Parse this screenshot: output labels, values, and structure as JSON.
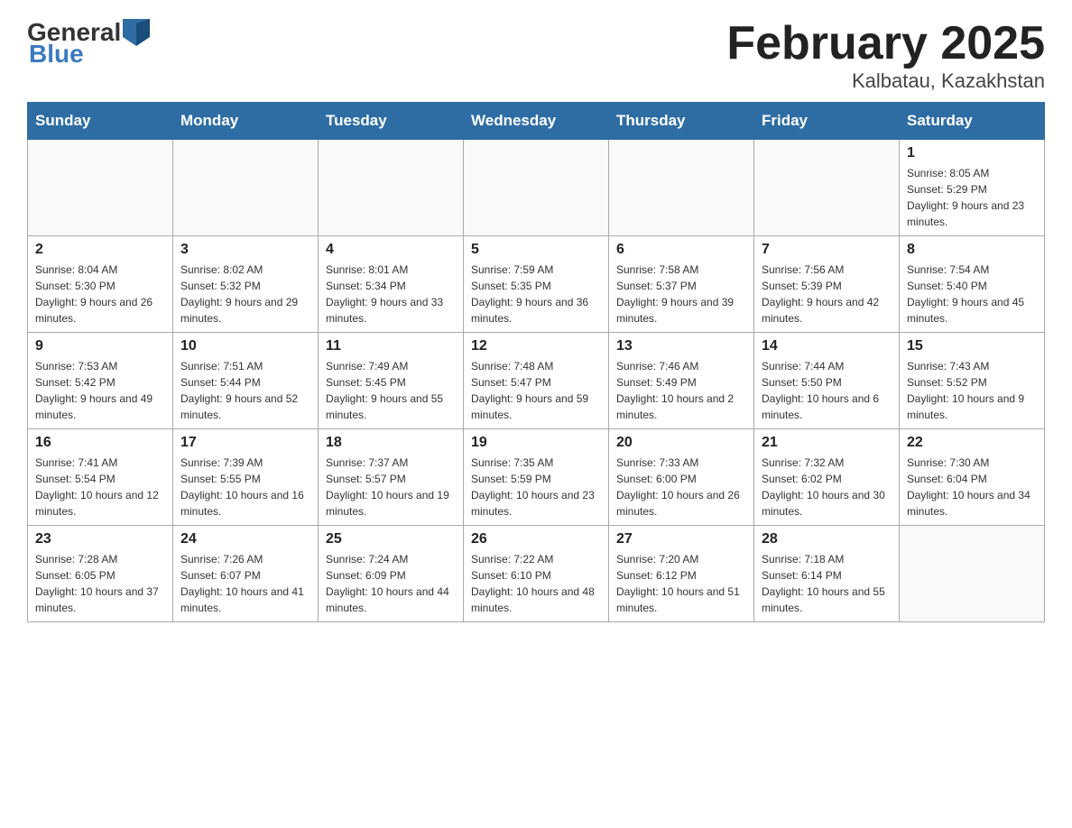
{
  "header": {
    "logo_general": "General",
    "logo_blue": "Blue",
    "month_title": "February 2025",
    "location": "Kalbatau, Kazakhstan"
  },
  "days_of_week": [
    "Sunday",
    "Monday",
    "Tuesday",
    "Wednesday",
    "Thursday",
    "Friday",
    "Saturday"
  ],
  "weeks": [
    [
      {
        "day": "",
        "sunrise": "",
        "sunset": "",
        "daylight": ""
      },
      {
        "day": "",
        "sunrise": "",
        "sunset": "",
        "daylight": ""
      },
      {
        "day": "",
        "sunrise": "",
        "sunset": "",
        "daylight": ""
      },
      {
        "day": "",
        "sunrise": "",
        "sunset": "",
        "daylight": ""
      },
      {
        "day": "",
        "sunrise": "",
        "sunset": "",
        "daylight": ""
      },
      {
        "day": "",
        "sunrise": "",
        "sunset": "",
        "daylight": ""
      },
      {
        "day": "1",
        "sunrise": "Sunrise: 8:05 AM",
        "sunset": "Sunset: 5:29 PM",
        "daylight": "Daylight: 9 hours and 23 minutes."
      }
    ],
    [
      {
        "day": "2",
        "sunrise": "Sunrise: 8:04 AM",
        "sunset": "Sunset: 5:30 PM",
        "daylight": "Daylight: 9 hours and 26 minutes."
      },
      {
        "day": "3",
        "sunrise": "Sunrise: 8:02 AM",
        "sunset": "Sunset: 5:32 PM",
        "daylight": "Daylight: 9 hours and 29 minutes."
      },
      {
        "day": "4",
        "sunrise": "Sunrise: 8:01 AM",
        "sunset": "Sunset: 5:34 PM",
        "daylight": "Daylight: 9 hours and 33 minutes."
      },
      {
        "day": "5",
        "sunrise": "Sunrise: 7:59 AM",
        "sunset": "Sunset: 5:35 PM",
        "daylight": "Daylight: 9 hours and 36 minutes."
      },
      {
        "day": "6",
        "sunrise": "Sunrise: 7:58 AM",
        "sunset": "Sunset: 5:37 PM",
        "daylight": "Daylight: 9 hours and 39 minutes."
      },
      {
        "day": "7",
        "sunrise": "Sunrise: 7:56 AM",
        "sunset": "Sunset: 5:39 PM",
        "daylight": "Daylight: 9 hours and 42 minutes."
      },
      {
        "day": "8",
        "sunrise": "Sunrise: 7:54 AM",
        "sunset": "Sunset: 5:40 PM",
        "daylight": "Daylight: 9 hours and 45 minutes."
      }
    ],
    [
      {
        "day": "9",
        "sunrise": "Sunrise: 7:53 AM",
        "sunset": "Sunset: 5:42 PM",
        "daylight": "Daylight: 9 hours and 49 minutes."
      },
      {
        "day": "10",
        "sunrise": "Sunrise: 7:51 AM",
        "sunset": "Sunset: 5:44 PM",
        "daylight": "Daylight: 9 hours and 52 minutes."
      },
      {
        "day": "11",
        "sunrise": "Sunrise: 7:49 AM",
        "sunset": "Sunset: 5:45 PM",
        "daylight": "Daylight: 9 hours and 55 minutes."
      },
      {
        "day": "12",
        "sunrise": "Sunrise: 7:48 AM",
        "sunset": "Sunset: 5:47 PM",
        "daylight": "Daylight: 9 hours and 59 minutes."
      },
      {
        "day": "13",
        "sunrise": "Sunrise: 7:46 AM",
        "sunset": "Sunset: 5:49 PM",
        "daylight": "Daylight: 10 hours and 2 minutes."
      },
      {
        "day": "14",
        "sunrise": "Sunrise: 7:44 AM",
        "sunset": "Sunset: 5:50 PM",
        "daylight": "Daylight: 10 hours and 6 minutes."
      },
      {
        "day": "15",
        "sunrise": "Sunrise: 7:43 AM",
        "sunset": "Sunset: 5:52 PM",
        "daylight": "Daylight: 10 hours and 9 minutes."
      }
    ],
    [
      {
        "day": "16",
        "sunrise": "Sunrise: 7:41 AM",
        "sunset": "Sunset: 5:54 PM",
        "daylight": "Daylight: 10 hours and 12 minutes."
      },
      {
        "day": "17",
        "sunrise": "Sunrise: 7:39 AM",
        "sunset": "Sunset: 5:55 PM",
        "daylight": "Daylight: 10 hours and 16 minutes."
      },
      {
        "day": "18",
        "sunrise": "Sunrise: 7:37 AM",
        "sunset": "Sunset: 5:57 PM",
        "daylight": "Daylight: 10 hours and 19 minutes."
      },
      {
        "day": "19",
        "sunrise": "Sunrise: 7:35 AM",
        "sunset": "Sunset: 5:59 PM",
        "daylight": "Daylight: 10 hours and 23 minutes."
      },
      {
        "day": "20",
        "sunrise": "Sunrise: 7:33 AM",
        "sunset": "Sunset: 6:00 PM",
        "daylight": "Daylight: 10 hours and 26 minutes."
      },
      {
        "day": "21",
        "sunrise": "Sunrise: 7:32 AM",
        "sunset": "Sunset: 6:02 PM",
        "daylight": "Daylight: 10 hours and 30 minutes."
      },
      {
        "day": "22",
        "sunrise": "Sunrise: 7:30 AM",
        "sunset": "Sunset: 6:04 PM",
        "daylight": "Daylight: 10 hours and 34 minutes."
      }
    ],
    [
      {
        "day": "23",
        "sunrise": "Sunrise: 7:28 AM",
        "sunset": "Sunset: 6:05 PM",
        "daylight": "Daylight: 10 hours and 37 minutes."
      },
      {
        "day": "24",
        "sunrise": "Sunrise: 7:26 AM",
        "sunset": "Sunset: 6:07 PM",
        "daylight": "Daylight: 10 hours and 41 minutes."
      },
      {
        "day": "25",
        "sunrise": "Sunrise: 7:24 AM",
        "sunset": "Sunset: 6:09 PM",
        "daylight": "Daylight: 10 hours and 44 minutes."
      },
      {
        "day": "26",
        "sunrise": "Sunrise: 7:22 AM",
        "sunset": "Sunset: 6:10 PM",
        "daylight": "Daylight: 10 hours and 48 minutes."
      },
      {
        "day": "27",
        "sunrise": "Sunrise: 7:20 AM",
        "sunset": "Sunset: 6:12 PM",
        "daylight": "Daylight: 10 hours and 51 minutes."
      },
      {
        "day": "28",
        "sunrise": "Sunrise: 7:18 AM",
        "sunset": "Sunset: 6:14 PM",
        "daylight": "Daylight: 10 hours and 55 minutes."
      },
      {
        "day": "",
        "sunrise": "",
        "sunset": "",
        "daylight": ""
      }
    ]
  ]
}
